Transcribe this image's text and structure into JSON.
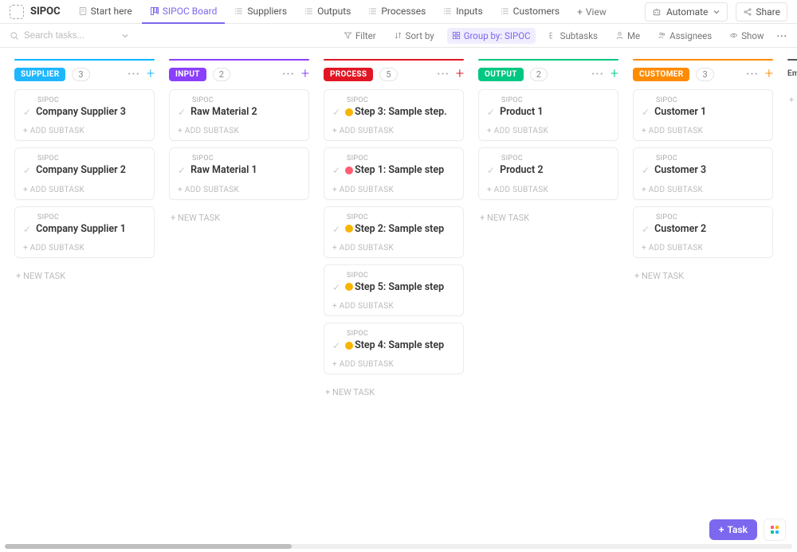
{
  "app_title": "SIPOC",
  "tabs": [
    {
      "label": "Start here"
    },
    {
      "label": "SIPOC Board"
    },
    {
      "label": "Suppliers"
    },
    {
      "label": "Outputs"
    },
    {
      "label": "Processes"
    },
    {
      "label": "Inputs"
    },
    {
      "label": "Customers"
    }
  ],
  "view_label": "View",
  "automate_label": "Automate",
  "share_label": "Share",
  "search_placeholder": "Search tasks...",
  "filter_label": "Filter",
  "sort_label": "Sort by",
  "group_label": "Group by: SIPOC",
  "subtasks_label": "Subtasks",
  "me_label": "Me",
  "assignees_label": "Assignees",
  "show_label": "Show",
  "card_tag": "SIPOC",
  "add_subtask_label": "+ ADD SUBTASK",
  "new_task_label": "+ NEW TASK",
  "task_button_label": "Task",
  "columns": [
    {
      "id": "supplier",
      "label": "SUPPLIER",
      "count": "3",
      "color_line": "#00b8ff",
      "color_chip": "#1fb6ff",
      "plus_color": "#1fb6ff",
      "cards": [
        {
          "title": "Company Supplier 3"
        },
        {
          "title": "Company Supplier 2"
        },
        {
          "title": "Company Supplier 1"
        }
      ]
    },
    {
      "id": "input",
      "label": "INPUT",
      "count": "2",
      "color_line": "#8a3ffc",
      "color_chip": "#8a3ffc",
      "plus_color": "#8a3ffc",
      "cards": [
        {
          "title": "Raw Material 2"
        },
        {
          "title": "Raw Material 1"
        }
      ]
    },
    {
      "id": "process",
      "label": "PROCESS",
      "count": "5",
      "color_line": "#e11624",
      "color_chip": "#e11624",
      "plus_color": "#e11624",
      "cards": [
        {
          "title": "Step 3: Sample step.",
          "status": "#f7b500"
        },
        {
          "title": "Step 1: Sample step",
          "status": "#ff5c72"
        },
        {
          "title": "Step 2: Sample step",
          "status": "#f7b500"
        },
        {
          "title": "Step 5: Sample step",
          "status": "#f7b500"
        },
        {
          "title": "Step 4: Sample step",
          "status": "#f7b500"
        }
      ]
    },
    {
      "id": "output",
      "label": "OUTPUT",
      "count": "2",
      "color_line": "#00c781",
      "color_chip": "#00c781",
      "plus_color": "#00c781",
      "cards": [
        {
          "title": "Product 1"
        },
        {
          "title": "Product 2"
        }
      ]
    },
    {
      "id": "customer",
      "label": "CUSTOMER",
      "count": "3",
      "color_line": "#ff8b00",
      "color_chip": "#ff8b00",
      "plus_color": "#ff8b00",
      "cards": [
        {
          "title": "Customer 1"
        },
        {
          "title": "Customer 3"
        },
        {
          "title": "Customer 2"
        }
      ]
    },
    {
      "id": "empty",
      "label": "Empt",
      "count": "",
      "color_line": "#555",
      "color_chip": "transparent",
      "plus_color": "#888",
      "partial": true,
      "cards": []
    }
  ]
}
